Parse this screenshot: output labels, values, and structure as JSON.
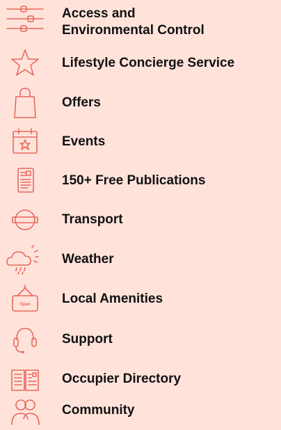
{
  "menu": {
    "items": [
      {
        "label_line1": "Access and",
        "label_line2": "Environmental Control",
        "icon": "sliders-icon"
      },
      {
        "label": "Lifestyle Concierge Service",
        "icon": "star-icon"
      },
      {
        "label": "Offers",
        "icon": "shopping-bag-icon"
      },
      {
        "label": "Events",
        "icon": "calendar-star-icon"
      },
      {
        "label": "150+ Free Publications",
        "icon": "publication-icon"
      },
      {
        "label": "Transport",
        "icon": "transport-roundel-icon"
      },
      {
        "label": "Weather",
        "icon": "weather-cloud-sun-icon"
      },
      {
        "label": "Local Amenities",
        "icon": "open-sign-icon",
        "icon_text": "Open"
      },
      {
        "label": "Support",
        "icon": "headset-icon"
      },
      {
        "label": "Occupier Directory",
        "icon": "open-book-icon"
      },
      {
        "label": "Community",
        "icon": "people-icon"
      }
    ]
  },
  "colors": {
    "background": "#FFE3DB",
    "accent": "#E8685A",
    "text": "#111111"
  }
}
